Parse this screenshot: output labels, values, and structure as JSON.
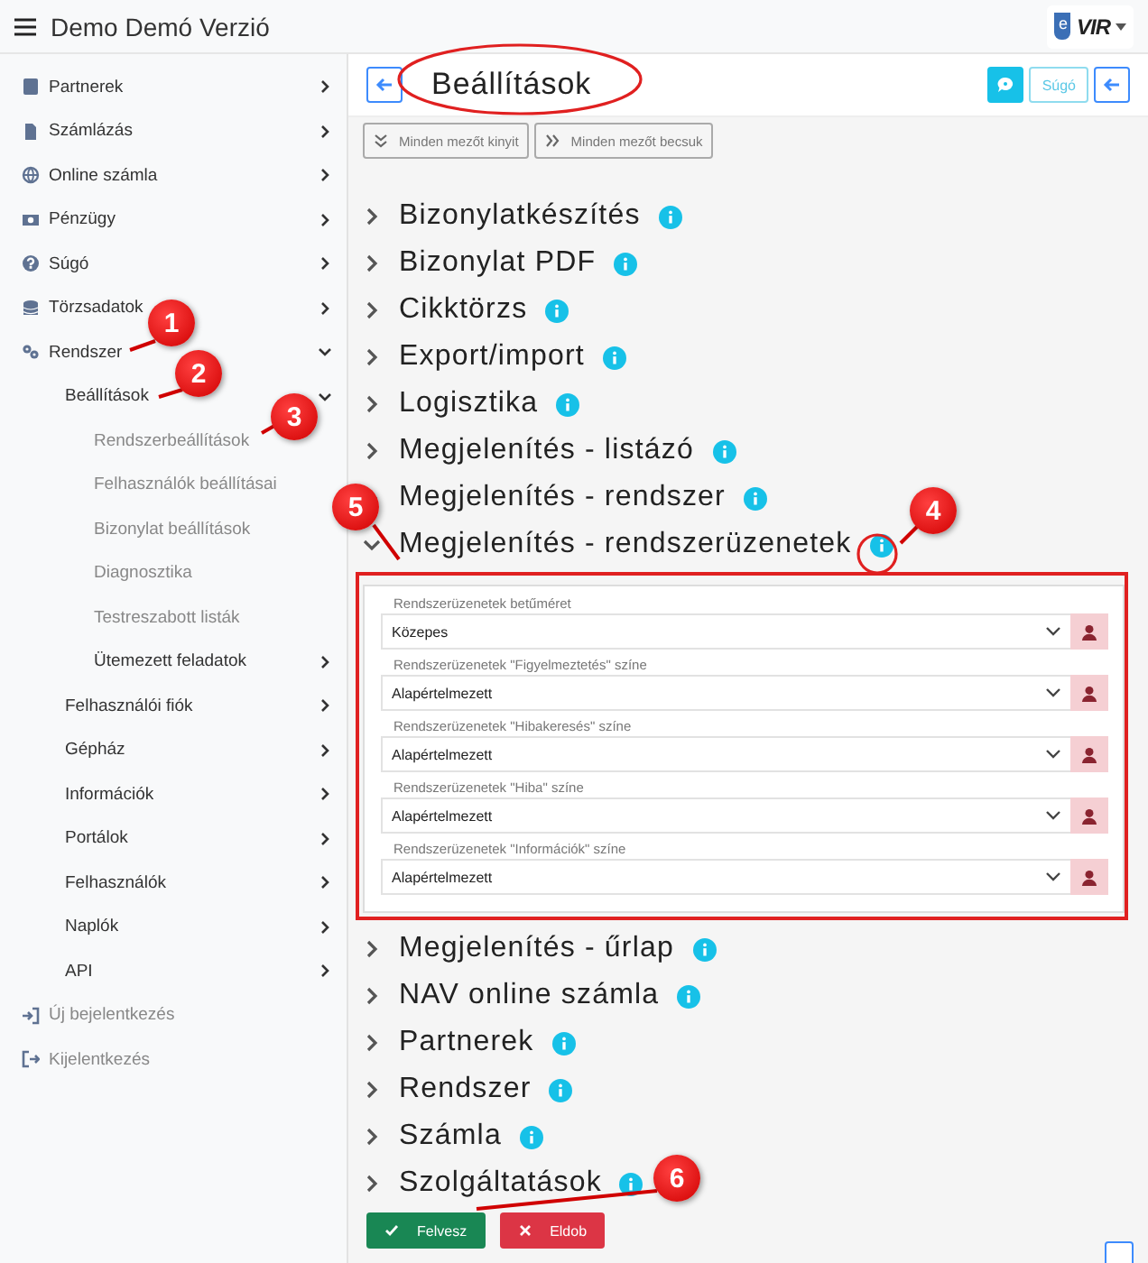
{
  "app_bar": {
    "title": "Demo Demó Verzió",
    "logo": {
      "mark": "e",
      "text": "VIR"
    }
  },
  "sidebar": {
    "items": [
      {
        "label": "Partnerek",
        "expanded": false
      },
      {
        "label": "Számlázás",
        "expanded": false
      },
      {
        "label": "Online számla",
        "expanded": false
      },
      {
        "label": "Pénzügy",
        "expanded": false
      },
      {
        "label": "Súgó",
        "expanded": false
      },
      {
        "label": "Törzsadatok",
        "expanded": false
      },
      {
        "label": "Rendszer",
        "expanded": true,
        "children": [
          {
            "label": "Beállítások",
            "expanded": true,
            "children": [
              {
                "label": "Rendszerbeállítások"
              },
              {
                "label": "Felhasználók beállításai"
              },
              {
                "label": "Bizonylat beállítások"
              },
              {
                "label": "Diagnosztika"
              },
              {
                "label": "Testreszabott listák"
              },
              {
                "label": "Ütemezett feladatok",
                "expanded": false
              }
            ]
          },
          {
            "label": "Felhasználói fiók",
            "expanded": false
          },
          {
            "label": "Gépház",
            "expanded": false
          },
          {
            "label": "Információk",
            "expanded": false
          },
          {
            "label": "Portálok",
            "expanded": false
          },
          {
            "label": "Felhasználók",
            "expanded": false
          },
          {
            "label": "Naplók",
            "expanded": false
          },
          {
            "label": "API",
            "expanded": false
          }
        ]
      }
    ],
    "footer_links": [
      {
        "label": "Új bejelentkezés"
      },
      {
        "label": "Kijelentkezés"
      }
    ]
  },
  "page": {
    "title": "Beállítások",
    "help_button": "Súgó",
    "toolbar": [
      "Minden mezőt kinyit",
      "Minden mezőt becsuk"
    ]
  },
  "sections": [
    {
      "title": "Bizonylatkészítés",
      "expanded": false
    },
    {
      "title": "Bizonylat PDF",
      "expanded": false
    },
    {
      "title": "Cikktörzs",
      "expanded": false
    },
    {
      "title": "Export/import",
      "expanded": false
    },
    {
      "title": "Logisztika",
      "expanded": false
    },
    {
      "title": "Megjelenítés - listázó",
      "expanded": false
    },
    {
      "title": "Megjelenítés - rendszer",
      "expanded": false
    },
    {
      "title": "Megjelenítés - rendszerüzenetek",
      "expanded": true,
      "fields": [
        {
          "label": "Rendszerüzenetek betűméret",
          "value": "Közepes"
        },
        {
          "label": "Rendszerüzenetek \"Figyelmeztetés\" színe",
          "value": "Alapértelmezett"
        },
        {
          "label": "Rendszerüzenetek \"Hibakeresés\" színe",
          "value": "Alapértelmezett"
        },
        {
          "label": "Rendszerüzenetek \"Hiba\" színe",
          "value": "Alapértelmezett"
        },
        {
          "label": "Rendszerüzenetek \"Információk\" színe",
          "value": "Alapértelmezett"
        }
      ]
    },
    {
      "title": "Megjelenítés - űrlap",
      "expanded": false
    },
    {
      "title": "NAV online számla",
      "expanded": false
    },
    {
      "title": "Partnerek",
      "expanded": false
    },
    {
      "title": "Rendszer",
      "expanded": false
    },
    {
      "title": "Számla",
      "expanded": false
    },
    {
      "title": "Szolgáltatások",
      "expanded": false
    }
  ],
  "actions": [
    {
      "label": "Felvesz",
      "kind": "save"
    },
    {
      "label": "Eldob",
      "kind": "discard"
    }
  ],
  "callouts": [
    "1",
    "2",
    "3",
    "4",
    "5",
    "6"
  ]
}
